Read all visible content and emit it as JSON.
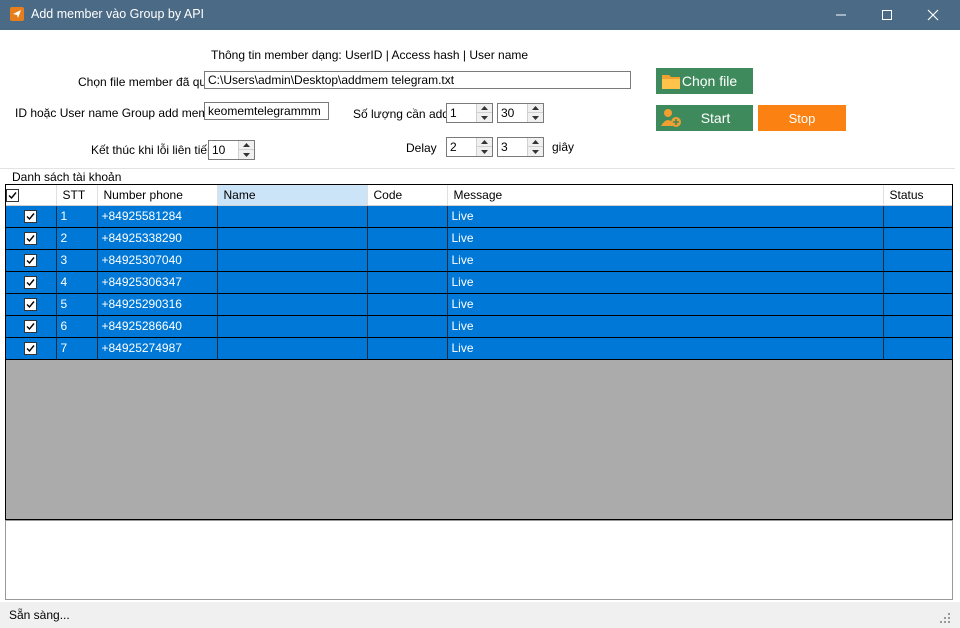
{
  "window": {
    "title": "Add member vào Group by API",
    "minimize_icon": "minimize-icon",
    "maximize_icon": "maximize-icon",
    "close_icon": "close-icon"
  },
  "form": {
    "info_text": "Thông tin member dạng: UserID | Access hash | User name",
    "file_label": "Chọn file member đã quét",
    "file_value": "C:\\Users\\admin\\Desktop\\addmem telegram.txt",
    "group_label": "ID hoặc User name Group add member",
    "group_value": "keomemtelegrammm",
    "stop_errors_label": "Kết thúc khi lỗi liên tiếp",
    "stop_errors_value": "10",
    "amount_label": "Số lượng cần add",
    "amount_from": "1",
    "amount_to": "30",
    "delay_label": "Delay",
    "delay_from": "2",
    "delay_to": "3",
    "delay_unit": "giây"
  },
  "buttons": {
    "choose_file": "Chọn file",
    "start": "Start",
    "stop": "Stop"
  },
  "accounts": {
    "group_title": "Danh sách tài khoản",
    "columns": [
      "STT",
      "Number phone",
      "Name",
      "Code",
      "Message",
      "Status"
    ],
    "rows": [
      {
        "stt": "1",
        "phone": "+84925581284",
        "name": "",
        "code": "",
        "message": "Live",
        "status": ""
      },
      {
        "stt": "2",
        "phone": "+84925338290",
        "name": "",
        "code": "",
        "message": "Live",
        "status": ""
      },
      {
        "stt": "3",
        "phone": "+84925307040",
        "name": "",
        "code": "",
        "message": "Live",
        "status": ""
      },
      {
        "stt": "4",
        "phone": "+84925306347",
        "name": "",
        "code": "",
        "message": "Live",
        "status": ""
      },
      {
        "stt": "5",
        "phone": "+84925290316",
        "name": "",
        "code": "",
        "message": "Live",
        "status": ""
      },
      {
        "stt": "6",
        "phone": "+84925286640",
        "name": "",
        "code": "",
        "message": "Live",
        "status": ""
      },
      {
        "stt": "7",
        "phone": "+84925274987",
        "name": "",
        "code": "",
        "message": "Live",
        "status": ""
      }
    ]
  },
  "statusbar": {
    "text": "Sẵn sàng..."
  },
  "colors": {
    "titlebar": "#4b6a86",
    "row_selected": "#0078d7",
    "button_green": "#3e8a5c",
    "button_orange": "#fb8112"
  }
}
